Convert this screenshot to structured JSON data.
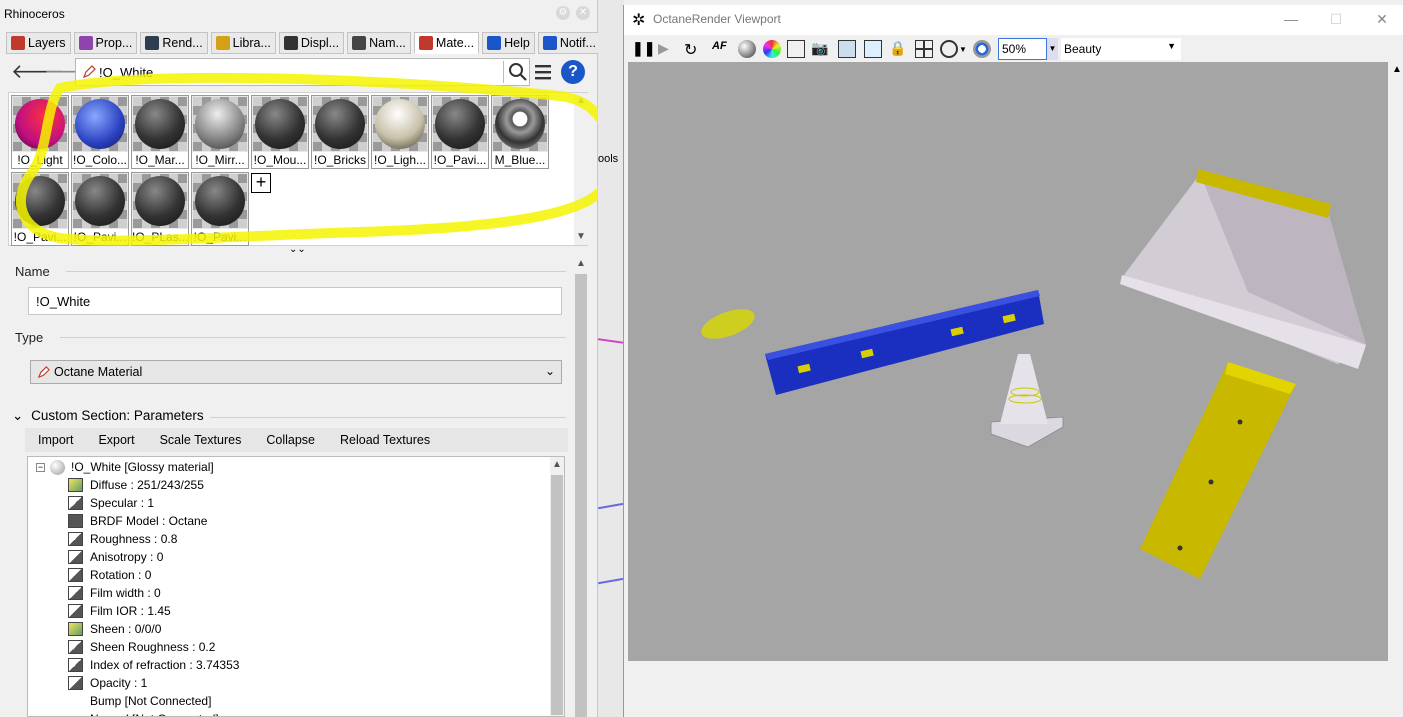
{
  "rhino": {
    "title": "Rhinoceros",
    "tabs": [
      {
        "label": "Layers",
        "icon": "layers-icon",
        "color": "#c0392b"
      },
      {
        "label": "Prop...",
        "icon": "properties-icon",
        "color": "#8e44ad"
      },
      {
        "label": "Rend...",
        "icon": "rendering-icon",
        "color": "#2c3e50"
      },
      {
        "label": "Libra...",
        "icon": "folder-icon",
        "color": "#d4a017"
      },
      {
        "label": "Displ...",
        "icon": "display-icon",
        "color": "#333333"
      },
      {
        "label": "Nam...",
        "icon": "camera-icon",
        "color": "#444444"
      },
      {
        "label": "Mate...",
        "icon": "material-icon",
        "color": "#c0392b"
      },
      {
        "label": "Help",
        "icon": "help-icon",
        "color": "#1a56c8"
      },
      {
        "label": "Notif...",
        "icon": "bell-icon",
        "color": "#1a56c8"
      }
    ],
    "search": {
      "value": "!O_White"
    },
    "materials": [
      {
        "label": "!O_Light",
        "ball": "magenta"
      },
      {
        "label": "!O_Colo...",
        "ball": "blue"
      },
      {
        "label": "!O_Mar...",
        "ball": "dark"
      },
      {
        "label": "!O_Mirr...",
        "ball": "grey"
      },
      {
        "label": "!O_Mou...",
        "ball": "dark"
      },
      {
        "label": "!O_Bricks",
        "ball": "dark"
      },
      {
        "label": "!O_Ligh...",
        "ball": "cream"
      },
      {
        "label": "!O_Pavi...",
        "ball": "dark"
      },
      {
        "label": "M_Blue...",
        "ball": "cam"
      },
      {
        "label": "!O_Pavi...",
        "ball": "dark"
      },
      {
        "label": "!O_Pavi...",
        "ball": "dark"
      },
      {
        "label": "!O_PLas...",
        "ball": "dark"
      },
      {
        "label": "!O_Pavi...",
        "ball": "dark"
      }
    ],
    "name_section": {
      "label": "Name",
      "value": "!O_White"
    },
    "type_section": {
      "label": "Type",
      "value": "Octane Material"
    },
    "custom_section": {
      "label": "Custom Section: Parameters"
    },
    "param_buttons": [
      "Import",
      "Export",
      "Scale Textures",
      "Collapse",
      "Reload Textures"
    ],
    "tree": {
      "root": "!O_White  [Glossy material]",
      "items": [
        "Diffuse : 251/243/255",
        "Specular : 1",
        "BRDF Model : Octane",
        "Roughness : 0.8",
        "Anisotropy : 0",
        "Rotation : 0",
        "Film width : 0",
        "Film IOR : 1.45",
        "Sheen : 0/0/0",
        "Sheen Roughness : 0.2",
        "Index of refraction : 3.74353",
        "Opacity : 1",
        "Bump  [Not Connected]",
        "Normal  [Not Connected]"
      ]
    }
  },
  "octane": {
    "title": "OctaneRender Viewport",
    "zoom": "50%",
    "pass": "Beauty",
    "background_strip_text": "ools"
  },
  "colors": {
    "highlight": "#f5f500",
    "accent_blue": "#1a56c8",
    "viewport_bg": "#a5a5a5"
  }
}
